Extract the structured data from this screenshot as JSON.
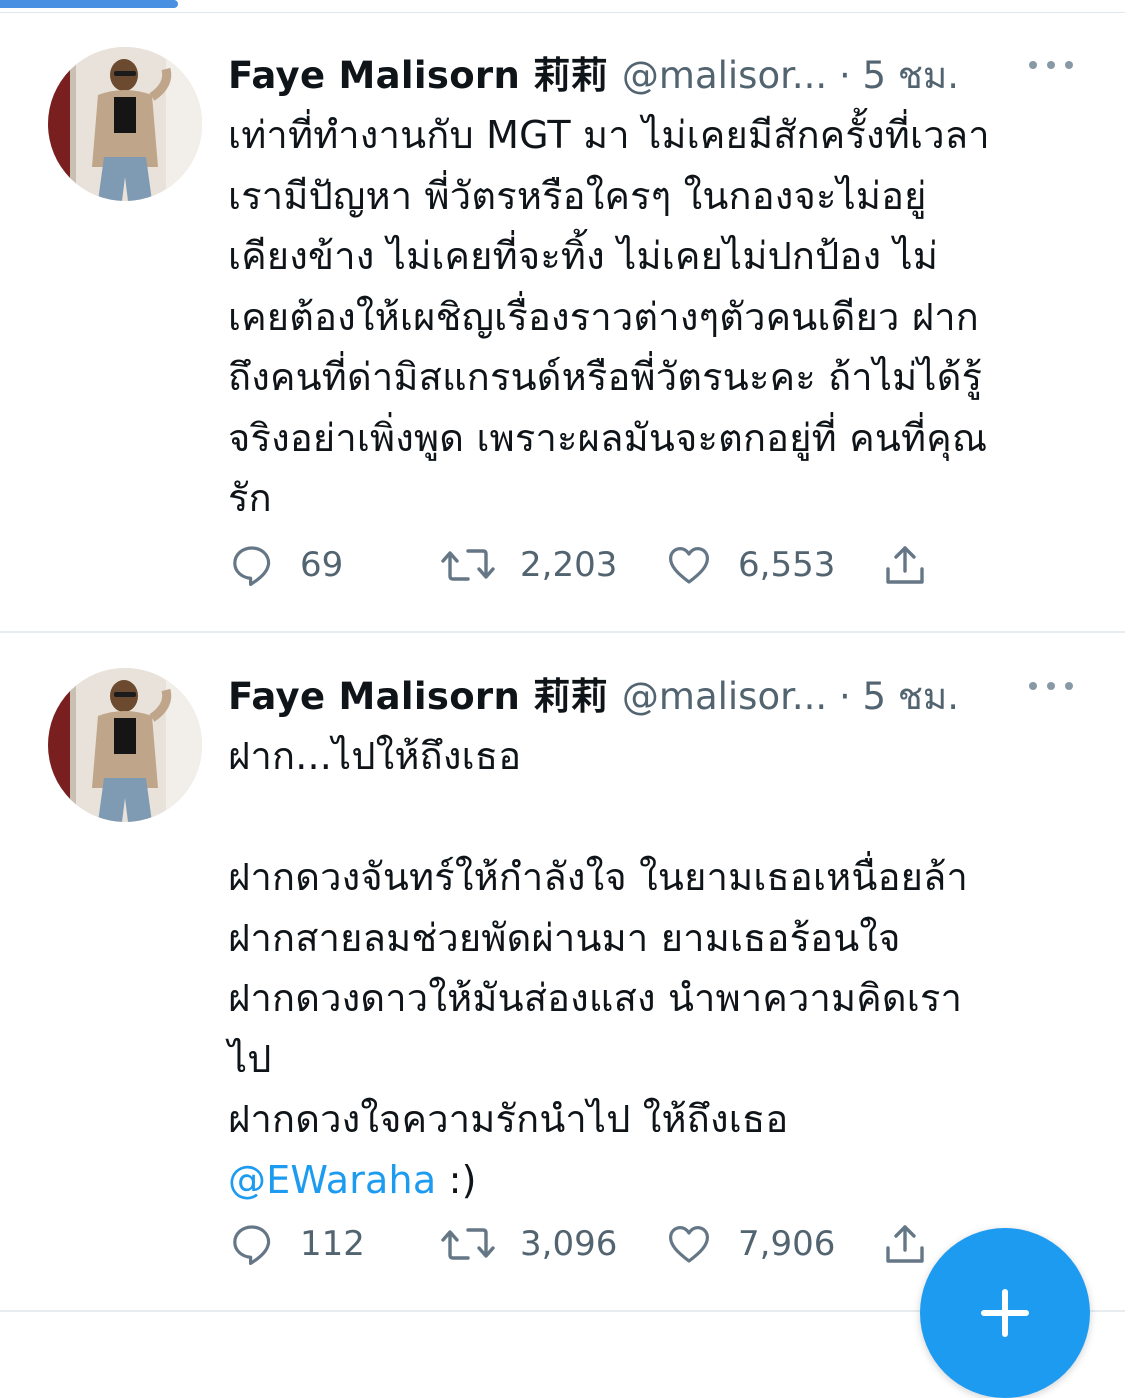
{
  "tweets": [
    {
      "author": {
        "display_name": "Faye Malisorn 莉莉",
        "handle": "@malisor...",
        "avatar_icon": "user-avatar-photo"
      },
      "time_separator": "·",
      "time": "5 ชม.",
      "handle_time": "@malisor... · 5 ชม.",
      "body_lines": [
        "เท่าที่ทำงานกับ MGT มา ไม่เคยมีสักครั้งที่เวลา",
        "เรามีปัญหา พี่วัตรหรือใครๆ ในกองจะไม่อยู่",
        "เคียงข้าง ไม่เคยที่จะทิ้ง ไม่เคยไม่ปกป้อง ไม่",
        "เคยต้องให้เผชิญเรื่องราวต่างๆตัวคนเดียว ฝาก",
        "ถึงคนที่ด่ามิสแกรนด์หรือพี่วัตรนะคะ  ถ้าไม่ได้รู้",
        "จริงอย่าเพิ่งพูด เพราะผลมันจะตกอยู่ที่ คนที่คุณ",
        "รัก"
      ],
      "stats": {
        "replies": "69",
        "retweets": "2,203",
        "likes": "6,553"
      }
    },
    {
      "author": {
        "display_name": "Faye Malisorn 莉莉",
        "handle": "@malisor...",
        "avatar_icon": "user-avatar-photo"
      },
      "time_separator": "·",
      "time": "5 ชม.",
      "handle_time": "@malisor... · 5 ชม.",
      "body_lines": [
        "ฝาก...ไปให้ถึงเธอ",
        "",
        "ฝากดวงจันทร์ให้กำลังใจ ในยามเธอเหนื่อยล้า",
        "ฝากสายลมช่วยพัดผ่านมา ยามเธอร้อนใจ",
        "ฝากดวงดาวให้มันส่องแสง นำพาความคิดเรา",
        "ไป",
        "ฝากดวงใจความรักนำไป ให้ถึงเธอ"
      ],
      "mention": "@EWaraha",
      "mention_suffix": " :)",
      "stats": {
        "replies": "112",
        "retweets": "3,096",
        "likes": "7,906"
      }
    }
  ],
  "icons": {
    "reply": "reply-icon",
    "retweet": "retweet-icon",
    "like": "like-icon",
    "share": "share-icon",
    "more": "more-icon",
    "compose": "compose-plus-icon"
  },
  "colors": {
    "accent": "#1d9bf0",
    "text": "#0f1419",
    "secondary": "#536471",
    "icon": "#657786"
  }
}
